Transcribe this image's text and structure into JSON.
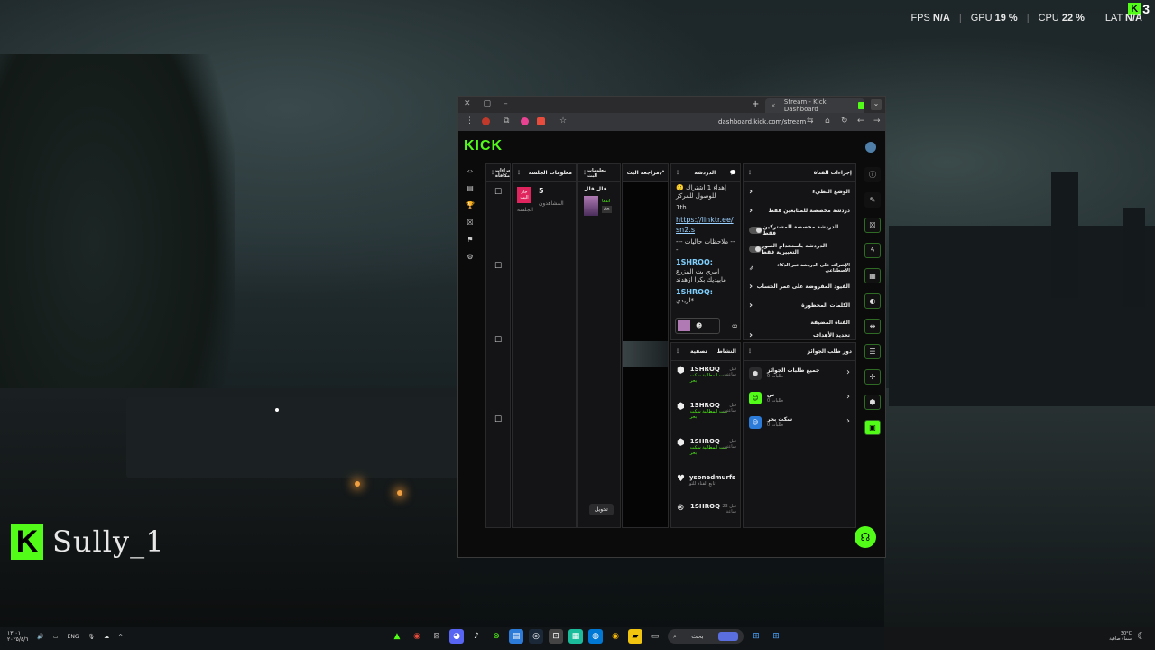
{
  "hud": {
    "fps_label": "FPS",
    "fps_value": "N/A",
    "gpu_label": "GPU",
    "gpu_value": "19 %",
    "cpu_label": "CPU",
    "cpu_value": "22 %",
    "lat_label": "LAT",
    "lat_value": "N/A",
    "sep": "|"
  },
  "badge": {
    "letter": "K",
    "count": "3"
  },
  "streamer": {
    "logo": "K",
    "name": "Sully_1"
  },
  "browser": {
    "tab_title": "Stream - Kick Dashboard",
    "url": "dashboard.kick.com/stream",
    "new_tab": "+",
    "close_tab": "×",
    "menu": "⌄"
  },
  "kick": {
    "logo": "KICK"
  },
  "left_rail": [
    "‹›",
    "▤",
    "🏆",
    "☒",
    "⚑",
    "⚙"
  ],
  "columns": {
    "rewards": {
      "title": "إجراءات مكافأة",
      "icon": "☐"
    },
    "session": {
      "title": "معلومات الجلسة",
      "badge": "جار البث",
      "sub": "الجلسة",
      "viewers": "5",
      "viewers_label": "المشاهدون"
    },
    "stream_info": {
      "title": "معلومات البث",
      "line1": "قلل قلل",
      "line2": "اندفا",
      "line3": "An",
      "button": "تحويل"
    },
    "preview": {
      "title": "مراجعة البث"
    },
    "chat": {
      "title": "الدردشة",
      "messages": [
        {
          "prefix": "🙂",
          "text": "إهداء 1 اشتراك للوصول للمركز"
        },
        {
          "text": "1th"
        },
        {
          "link": "https://linktr.ee/sn2.s"
        },
        {
          "note": "--- ملاحظات حاليات ---"
        },
        {
          "user": "1SHROQ:",
          "text": "ابيري بث المزرع مابيديك بكرا ازهدند"
        },
        {
          "user": "1SHROQ:",
          "text": "ازيدي*"
        }
      ],
      "infinity": "∞"
    },
    "activity": {
      "title": "النشاط",
      "filter": "تصفية",
      "rows": [
        {
          "icon": "⬢",
          "name": "1SHROQ",
          "action": "تمت المطالبة سكت بحر",
          "time": "قبل ساعتين"
        },
        {
          "icon": "⬢",
          "name": "1SHROQ",
          "action": "تمت المطالبة سكت بحر",
          "time": "قبل ساعتين"
        },
        {
          "icon": "⬢",
          "name": "1SHROQ",
          "action": "تمت المطالبة سكت بحر",
          "time": "قبل ساعتين"
        },
        {
          "icon": "♥",
          "name": "ysonedmurfs",
          "action": "تابع القناة للتو",
          "time": ""
        },
        {
          "icon": "⊗",
          "name": "1SHROQ",
          "action": "",
          "time": "قبل 23 ساعة"
        }
      ]
    },
    "channel_actions": {
      "title": "إجراءات القناة",
      "rows": [
        {
          "label": "الوضع البطيء",
          "type": "chev"
        },
        {
          "label": "دردشة مخصصة للمتابعين فقط",
          "type": "chev"
        },
        {
          "label": "الدردشة مخصصة للمشتركين فقط",
          "type": "toggle"
        },
        {
          "label": "الدردشة باستخدام الصور التعبيرية فقط",
          "type": "toggle"
        },
        {
          "label": "الإشراف على الدردشة عبر الذكاء الاصطناعي",
          "type": "ext"
        },
        {
          "label": "القيود المفروضة على عمر الحساب",
          "type": "chev"
        },
        {
          "label": "الكلمات المحظورة",
          "type": "chev"
        },
        {
          "label": "القناة المضيفة",
          "type": "none"
        },
        {
          "label": "تحديد الأهداف",
          "type": "chev"
        }
      ]
    },
    "reward_queue": {
      "title": "دور طلب الجوائز",
      "rows": [
        {
          "title": "جميع طلبات الجوائز",
          "sub": "طلبات 0",
          "color": "#2c2c2e",
          "ico": "⬢"
        },
        {
          "title": "س",
          "sub": "طلبات 0",
          "color": "#53fc18",
          "ico": "☺"
        },
        {
          "title": "سكت بحر",
          "sub": "طلبات 0",
          "color": "#2d7bd8",
          "ico": "☺"
        }
      ]
    }
  },
  "taskbar": {
    "left": [
      "١٣:٠١",
      "٢٠٢٥/٤/٦",
      "ENG"
    ],
    "search": "بحث",
    "weather_temp": "30°C",
    "weather_desc": "سماء صافية"
  }
}
